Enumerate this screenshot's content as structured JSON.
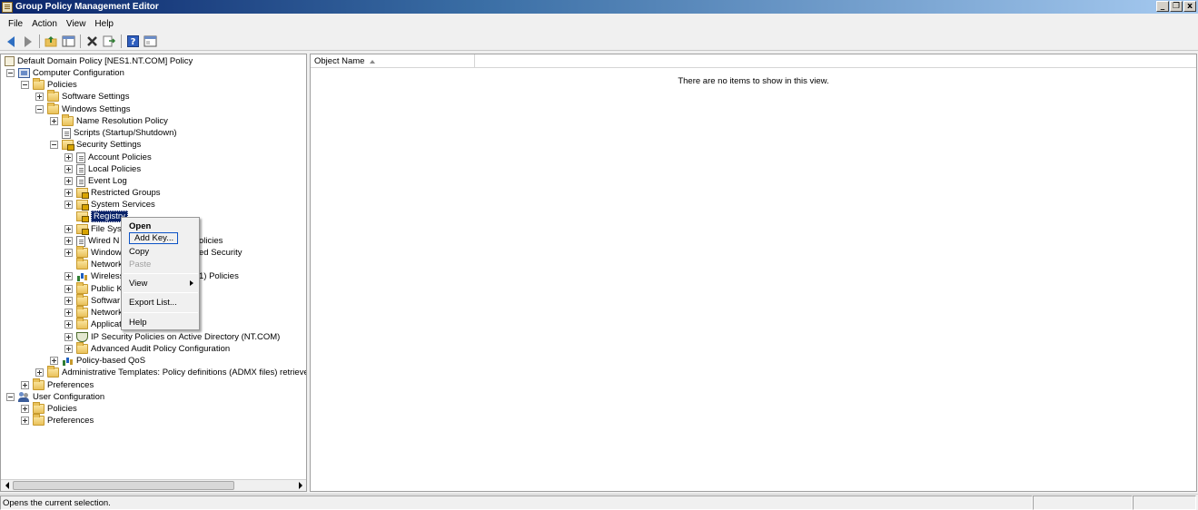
{
  "window": {
    "title": "Group Policy Management Editor",
    "controls": {
      "minimize": "_",
      "restore": "❐",
      "close": "x"
    }
  },
  "menu": [
    "File",
    "Action",
    "View",
    "Help"
  ],
  "toolbar": {
    "buttons": [
      "back-icon",
      "forward-icon",
      "up-folder-icon",
      "show-hide-tree-icon",
      "delete-icon",
      "export-list-icon",
      "help-icon",
      "properties-icon"
    ]
  },
  "tree": {
    "root": "Default Domain Policy [NES1.NT.COM] Policy",
    "computer_configuration": "Computer Configuration",
    "policies": "Policies",
    "software_settings": "Software Settings",
    "windows_settings": "Windows Settings",
    "name_resolution_policy": "Name Resolution Policy",
    "scripts": "Scripts (Startup/Shutdown)",
    "security_settings": "Security Settings",
    "account_policies": "Account Policies",
    "local_policies": "Local Policies",
    "event_log": "Event Log",
    "restricted_groups": "Restricted Groups",
    "system_services": "System Services",
    "registry": "Registry",
    "file_system": "File Syst",
    "wired_network_a": "Wired N",
    "wired_network_b": "olicies",
    "windows_firewall_a": "Window",
    "windows_firewall_b": "ed Security",
    "network_list": "Network",
    "wireless_a": "Wireless",
    "wireless_b": "1) Policies",
    "public_key": "Public Ke",
    "software_restriction": "Softwar",
    "network_access": "Network",
    "application_control": "Applicat",
    "ip_security": "IP Security Policies on Active Directory (NT.COM)",
    "advanced_audit": "Advanced Audit Policy Configuration",
    "policy_qos": "Policy-based QoS",
    "admin_templates": "Administrative Templates: Policy definitions (ADMX files) retrieved fr",
    "preferences": "Preferences",
    "user_configuration": "User Configuration",
    "user_policies": "Policies",
    "user_preferences": "Preferences"
  },
  "context_menu": {
    "open": "Open",
    "add_key": "Add Key...",
    "copy": "Copy",
    "paste": "Paste",
    "view": "View",
    "export_list": "Export List...",
    "help": "Help"
  },
  "list_view": {
    "column_object_name": "Object Name",
    "empty_message": "There are no items to show in this view."
  },
  "status_bar": {
    "text": "Opens the current selection."
  }
}
